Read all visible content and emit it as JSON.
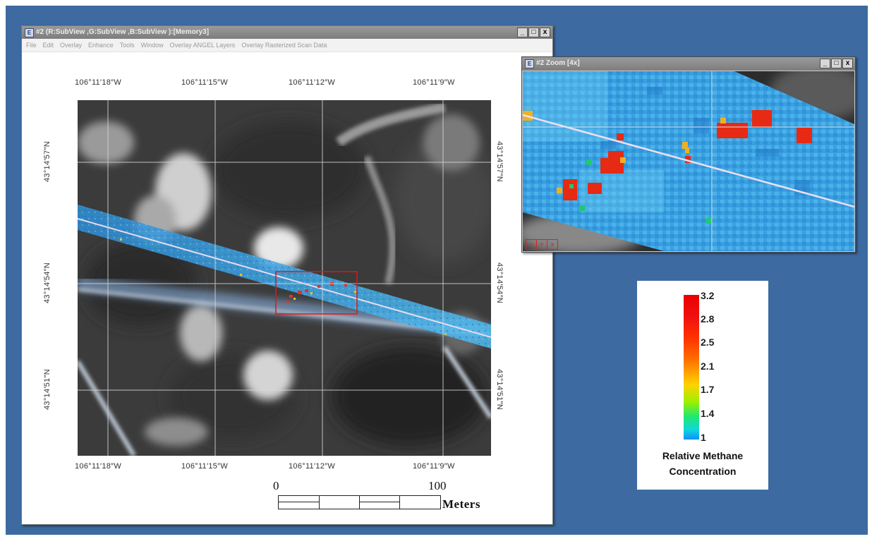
{
  "main_window": {
    "title": "#2 (R:SubView ,G:SubView ,B:SubView ):[Memory3]",
    "controls": {
      "minimize": "_",
      "maximize": "□",
      "close": "x"
    },
    "menu": [
      "File",
      "Edit",
      "Overlay",
      "Enhance",
      "Tools",
      "Window",
      "Overlay ANGEL Layers",
      "Overlay Rasterized Scan Data"
    ],
    "longitude_labels": [
      "106°11′18″W",
      "106°11′15″W",
      "106°11′12″W",
      "106°11′9″W"
    ],
    "latitude_labels": [
      "43°14′57″N",
      "43°14′54″N",
      "43°14′51″N"
    ],
    "scale": {
      "start": "0",
      "end": "100",
      "unit": "Meters"
    }
  },
  "zoom_window": {
    "title": "#2 Zoom [4x]",
    "controls": {
      "minimize": "_",
      "maximize": "□",
      "close": "x"
    },
    "zoom_buttons": [
      "−",
      "+",
      "x"
    ]
  },
  "legend": {
    "ticks": [
      "3.2",
      "2.8",
      "2.5",
      "2.1",
      "1.7",
      "1.4",
      "1"
    ],
    "title_line1": "Relative Methane",
    "title_line2": "Concentration",
    "colors": {
      "high": "#e80000",
      "mid": "#ffd200",
      "low": "#1090ff"
    }
  }
}
